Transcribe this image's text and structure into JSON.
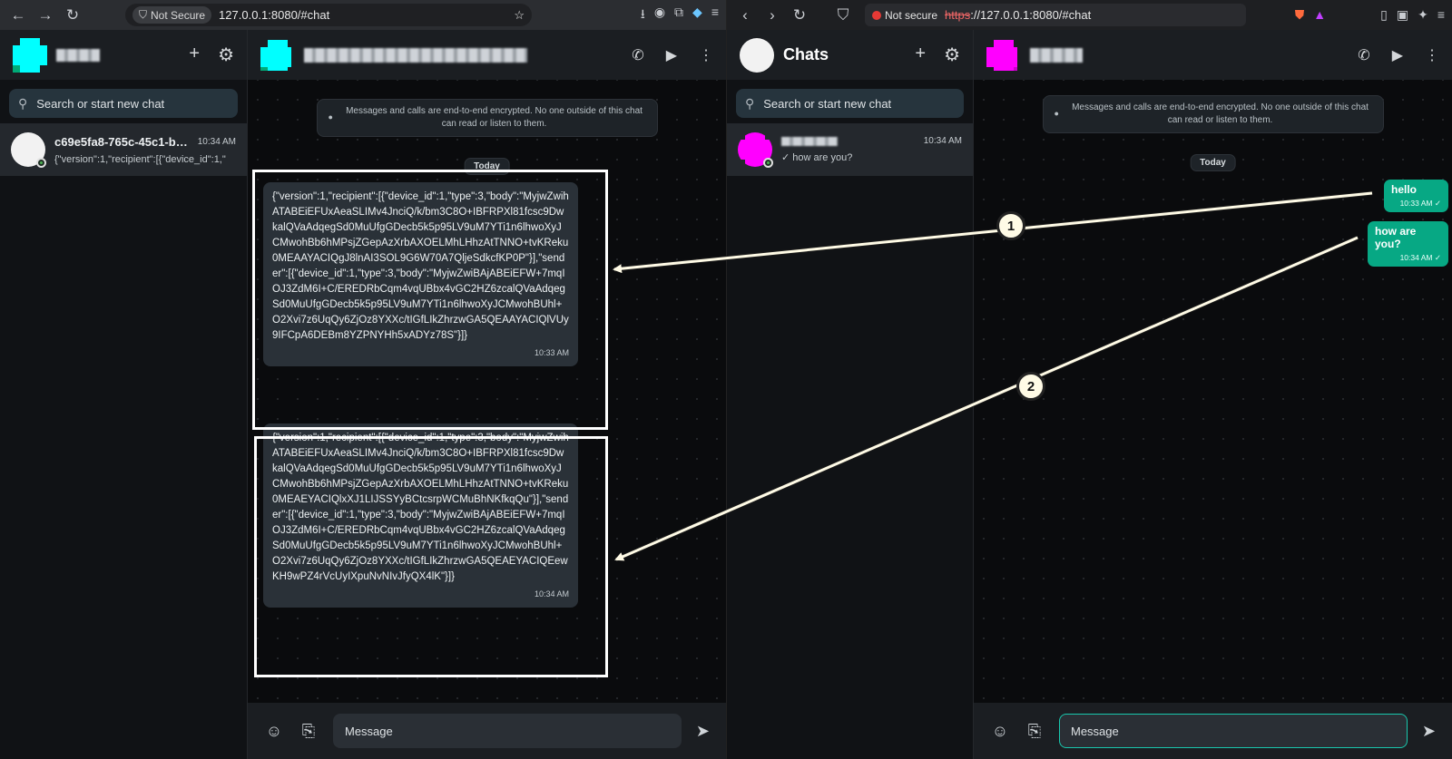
{
  "left_browser": {
    "security_label": "Not Secure",
    "url": "127.0.0.1:8080/#chat"
  },
  "right_browser": {
    "security_label": "Not secure",
    "url_scheme": "https",
    "url_rest": "://127.0.0.1:8080/#chat"
  },
  "left_app": {
    "search_placeholder": "Search or start new chat",
    "chat_item": {
      "name": "c69e5fa8-765c-45c1-b6...",
      "time": "10:34 AM",
      "preview": "{\"version\":1,\"recipient\":[{\"device_id\":1,\""
    },
    "encryption_notice": "Messages and calls are end-to-end encrypted. No one outside of this chat can read or listen to them.",
    "day_label": "Today",
    "messages": [
      {
        "text": "{\"version\":1,\"recipient\":[{\"device_id\":1,\"type\":3,\"body\":\"MyjwZwihATABEiEFUxAeaSLIMv4JnciQ/k/bm3C8O+IBFRPXl81fcsc9DwkalQVaAdqegSd0MuUfgGDecb5k5p95LV9uM7YTi1n6lhwoXyJCMwohBb6hMPsjZGepAzXrbAXOELMhLHhzAtTNNO+tvKReku0MEAAYACIQgJ8lnAI3SOL9G6W70A7QljeSdkcfKP0P\"}],\"sender\":[{\"device_id\":1,\"type\":3,\"body\":\"MyjwZwiBAjABEiEFW+7mqIOJ3ZdM6I+C/EREDRbCqm4vqUBbx4vGC2HZ6zcalQVaAdqegSd0MuUfgGDecb5k5p95LV9uM7YTi1n6lhwoXyJCMwohBUhl+O2Xvi7z6UqQy6ZjOz8YXXc/tIGfLIkZhrzwGA5QEAAYACIQlVUy9IFCpA6DEBm8YZPNYHh5xADYz78S\"}]}",
        "time": "10:33 AM"
      },
      {
        "text": "{\"version\":1,\"recipient\":[{\"device_id\":1,\"type\":3,\"body\":\"MyjwZwihATABEiEFUxAeaSLIMv4JnciQ/k/bm3C8O+IBFRPXl81fcsc9DwkalQVaAdqegSd0MuUfgGDecb5k5p95LV9uM7YTi1n6lhwoXyJCMwohBb6hMPsjZGepAzXrbAXOELMhLHhzAtTNNO+tvKReku0MEAEYACIQlxXJ1LIJSSYyBCtcsrpWCMuBhNKfkqQu\"}],\"sender\":[{\"device_id\":1,\"type\":3,\"body\":\"MyjwZwiBAjABEiEFW+7mqIOJ3ZdM6I+C/EREDRbCqm4vqUBbx4vGC2HZ6zcalQVaAdqegSd0MuUfgGDecb5k5p95LV9uM7YTi1n6lhwoXyJCMwohBUhl+O2Xvi7z6UqQy6ZjOz8YXXc/tIGfLIkZhrzwGA5QEAEYACIQEewKH9wPZ4rVcUyIXpuNvNIvJfyQX4lK\"}]}",
        "time": "10:34 AM"
      }
    ],
    "composer_placeholder": "Message"
  },
  "right_app": {
    "title": "Chats",
    "search_placeholder": "Search or start new chat",
    "chat_item": {
      "time": "10:34 AM",
      "preview": "how are you?"
    },
    "encryption_notice": "Messages and calls are end-to-end encrypted. No one outside of this chat can read or listen to them.",
    "day_label": "Today",
    "messages": [
      {
        "text": "hello",
        "time": "10:33 AM"
      },
      {
        "text": "how are you?",
        "time": "10:34 AM"
      }
    ],
    "composer_placeholder": "Message"
  },
  "annotations": {
    "badge_1": "1",
    "badge_2": "2"
  },
  "icons": [
    "back-icon",
    "forward-icon",
    "reload-icon",
    "star-icon",
    "download-icon",
    "bookmark-icon",
    "plus-icon",
    "gear-icon",
    "phone-icon",
    "video-icon",
    "more-icon",
    "search-icon",
    "lock-icon",
    "emoji-icon",
    "attach-icon",
    "send-icon",
    "check-icon"
  ],
  "colors": {
    "outgoing_bubble": "#07a884",
    "focus_ring": "#19c7ad",
    "header_bg": "#1b1e22",
    "incoming_bubble": "#2a3138"
  }
}
